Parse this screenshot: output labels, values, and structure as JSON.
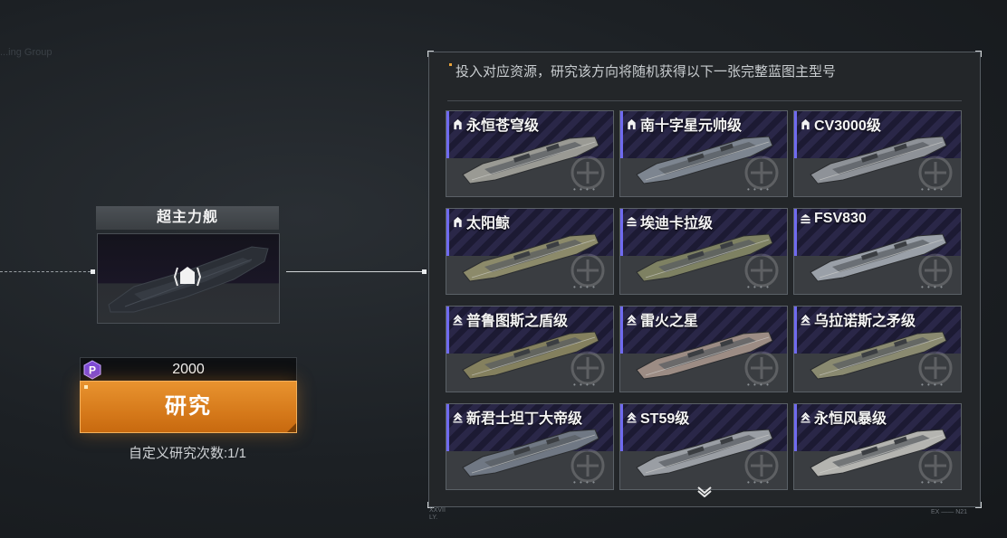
{
  "background_faint_text": "...ing Group",
  "left_card": {
    "category_title": "超主力舰",
    "badge_icon": "hexagon-capital-icon"
  },
  "cost": {
    "icon": "resource-p-icon",
    "value": "2000",
    "accent": "#7e4bd6"
  },
  "research_button": {
    "label": "研究",
    "color": "#e08a28"
  },
  "custom_research_count": "自定义研究次数:1/1",
  "panel": {
    "description": "投入对应资源，研究该方向将随机获得以下一张完整蓝图主型号",
    "footer_left": [
      "XXVII",
      "LY."
    ],
    "footer_right": "EX —— N21",
    "scroll_icon": "chevron-down-icon"
  },
  "ships": [
    {
      "name": "永恒苍穹级",
      "rank_icon": "rank-arch-icon",
      "hull": "#9a9a94"
    },
    {
      "name": "南十字星元帅级",
      "rank_icon": "rank-arch-icon",
      "hull": "#7d8590"
    },
    {
      "name": "CV3000级",
      "rank_icon": "rank-arch-icon",
      "hull": "#8e9298"
    },
    {
      "name": "太阳鲸",
      "rank_icon": "rank-arch-icon",
      "hull": "#8c8a6a"
    },
    {
      "name": "埃迪卡拉级",
      "rank_icon": "rank-triple-icon",
      "hull": "#7e8162"
    },
    {
      "name": "FSV830",
      "rank_icon": "rank-triple-icon",
      "hull": "#9aa0a8"
    },
    {
      "name": "普鲁图斯之盾级",
      "rank_icon": "rank-chevron-icon",
      "hull": "#84805e"
    },
    {
      "name": "雷火之星",
      "rank_icon": "rank-chevron-icon",
      "hull": "#9c8c84"
    },
    {
      "name": "乌拉诺斯之矛级",
      "rank_icon": "rank-chevron-icon",
      "hull": "#8a8a70"
    },
    {
      "name": "新君士坦丁大帝级",
      "rank_icon": "rank-chevron-icon",
      "hull": "#707884"
    },
    {
      "name": "ST59级",
      "rank_icon": "rank-chevron-icon",
      "hull": "#9a9ea4"
    },
    {
      "name": "永恒风暴级",
      "rank_icon": "rank-chevron-icon",
      "hull": "#b4b4b0"
    }
  ]
}
